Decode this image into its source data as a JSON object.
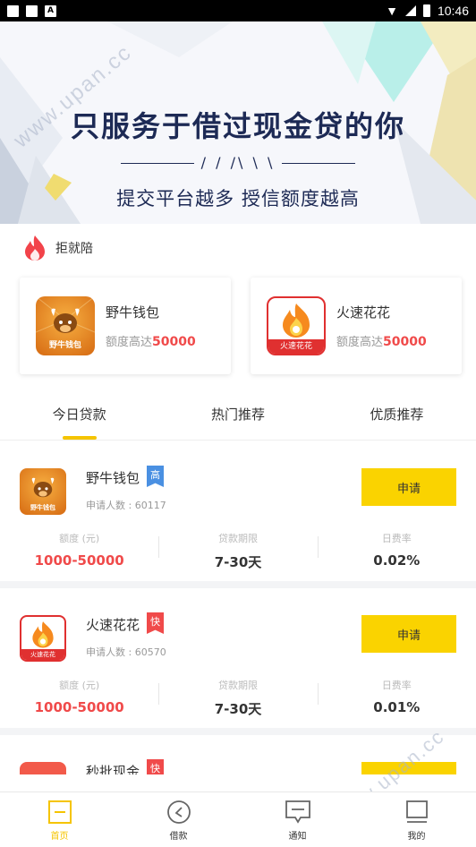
{
  "status_bar": {
    "time": "10:46"
  },
  "banner": {
    "title": "只服务于借过现金贷的你",
    "deco": "/ / /\\ \\ \\",
    "subtitle": "提交平台越多 授信额度越高",
    "watermark": "www.upan.cc"
  },
  "reject": {
    "label": "拒就陪"
  },
  "promo_cards": [
    {
      "name": "野牛钱包",
      "limit_prefix": "额度高达",
      "limit_value": "50000",
      "logo_text": "野牛钱包"
    },
    {
      "name": "火速花花",
      "limit_prefix": "额度高达",
      "limit_value": "50000",
      "logo_text": "火速花花"
    }
  ],
  "tabs": [
    {
      "label": "今日贷款"
    },
    {
      "label": "热门推荐"
    },
    {
      "label": "优质推荐"
    }
  ],
  "stat_labels": {
    "amount": "额度 (元)",
    "term": "贷款期限",
    "rate": "日费率"
  },
  "loans": [
    {
      "name": "野牛钱包",
      "tag": "高",
      "tag_color": "#4a90e2",
      "applicants": "申请人数 : 60117",
      "button": "申请",
      "amount": "1000-50000",
      "term": "7-30天",
      "rate": "0.02%",
      "logo_text": "野牛钱包"
    },
    {
      "name": "火速花花",
      "tag": "快",
      "tag_color": "#f04a4a",
      "applicants": "申请人数 : 60570",
      "button": "申请",
      "amount": "1000-50000",
      "term": "7-30天",
      "rate": "0.01%",
      "logo_text": "火速花花"
    },
    {
      "name": "秒批现金",
      "tag": "快",
      "tag_color": "#f04a4a"
    }
  ],
  "bottom_nav": [
    {
      "label": "首页",
      "icon": "home-icon",
      "active": true
    },
    {
      "label": "借款",
      "icon": "loan-icon",
      "active": false
    },
    {
      "label": "通知",
      "icon": "message-icon",
      "active": false
    },
    {
      "label": "我的",
      "icon": "profile-icon",
      "active": false
    }
  ],
  "colors": {
    "accent": "#fad300",
    "highlight": "#f04a4a",
    "banner_text": "#1d2a55"
  }
}
